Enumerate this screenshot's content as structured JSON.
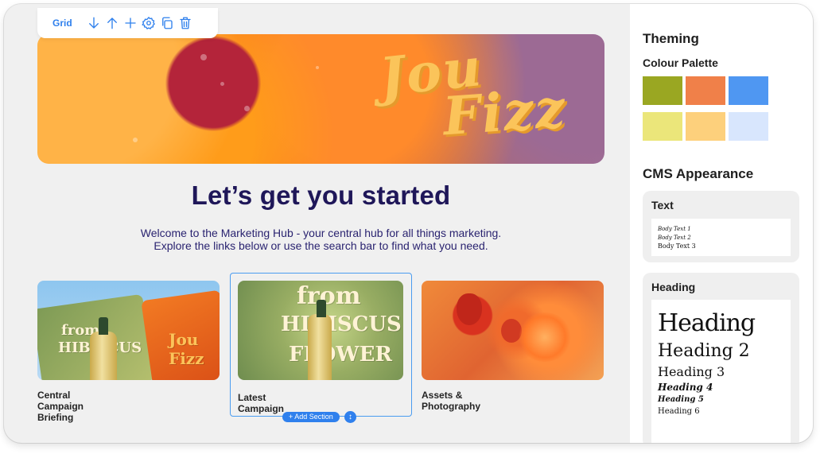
{
  "toolbar": {
    "grid_label": "Grid",
    "icons": [
      "arrow-down-icon",
      "arrow-up-icon",
      "plus-icon",
      "gear-icon",
      "copy-icon",
      "trash-icon"
    ]
  },
  "hero": {
    "logo_line1": "Jou",
    "logo_line2": "Fizz"
  },
  "page": {
    "title": "Let’s get you started",
    "welcome_line1": "Welcome to the Marketing Hub - your central hub for all things marketing.",
    "welcome_line2": "Explore the links below or use the search bar to find what you need."
  },
  "cards": [
    {
      "label": "Central Campaign Briefing",
      "thumb_text_1": "from",
      "thumb_text_2": "HIBISCUS",
      "thumb_logo": "Jou Fizz"
    },
    {
      "label": "Latest Campaign",
      "thumb_text_1": "from",
      "thumb_text_2": "HIBISCUS",
      "thumb_text_3": "FLOWER"
    },
    {
      "label": "Assets & Photography"
    }
  ],
  "section_controls": {
    "add_section_label": "+ Add Section",
    "handle_glyph": "↕"
  },
  "panel": {
    "theming_title": "Theming",
    "palette_title": "Colour Palette",
    "palette": [
      "#9aa722",
      "#f08049",
      "#4f97f2",
      "#ebe67a",
      "#fdd07c",
      "#d8e6fd"
    ],
    "cms_title": "CMS Appearance",
    "text_box": {
      "title": "Text",
      "samples": [
        "Body Text 1",
        "Body Text 2",
        "Body Text 3"
      ]
    },
    "heading_box": {
      "title": "Heading",
      "samples": [
        "Heading",
        "Heading 2",
        "Heading 3",
        "Heading 4",
        "Heading 5",
        "Heading 6"
      ]
    }
  }
}
